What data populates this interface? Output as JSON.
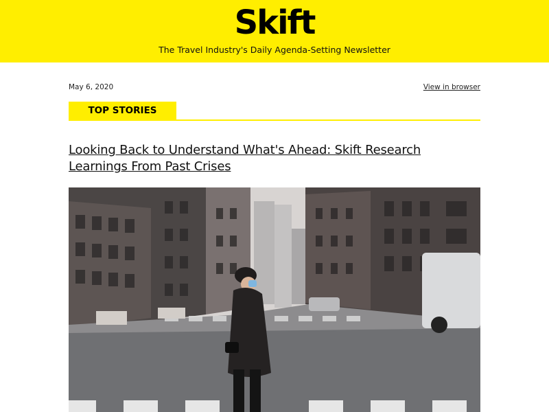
{
  "header": {
    "logo_text": "Skift",
    "tagline": "The Travel Industry's Daily Agenda-Setting Newsletter",
    "background_color": "#ffee00"
  },
  "meta": {
    "date": "May 6, 2020",
    "view_in_browser": "View in browser"
  },
  "section": {
    "label": "TOP STORIES",
    "accent_color": "#ffee00"
  },
  "article": {
    "headline": "Looking Back to Understand What's Ahead: Skift Research Learnings From Past Crises",
    "image": "photo of a masked pedestrian crossing an empty city street"
  }
}
